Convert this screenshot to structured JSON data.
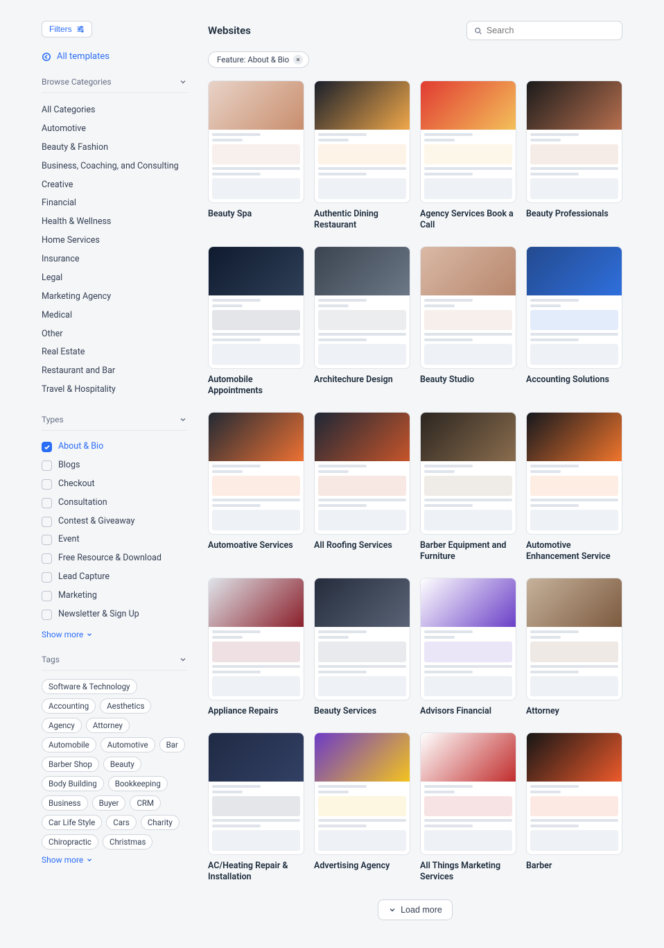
{
  "sidebar": {
    "filters_label": "Filters",
    "all_templates_label": "All templates",
    "browse_categories_label": "Browse Categories",
    "categories": [
      "All Categories",
      "Automotive",
      "Beauty & Fashion",
      "Business, Coaching, and Consulting",
      "Creative",
      "Financial",
      "Health & Wellness",
      "Home Services",
      "Insurance",
      "Legal",
      "Marketing Agency",
      "Medical",
      "Other",
      "Real Estate",
      "Restaurant and Bar",
      "Travel & Hospitality"
    ],
    "types_label": "Types",
    "types": [
      {
        "label": "About & Bio",
        "checked": true
      },
      {
        "label": "Blogs",
        "checked": false
      },
      {
        "label": "Checkout",
        "checked": false
      },
      {
        "label": "Consultation",
        "checked": false
      },
      {
        "label": "Contest & Giveaway",
        "checked": false
      },
      {
        "label": "Event",
        "checked": false
      },
      {
        "label": "Free Resource & Download",
        "checked": false
      },
      {
        "label": "Lead Capture",
        "checked": false
      },
      {
        "label": "Marketing",
        "checked": false
      },
      {
        "label": "Newsletter & Sign Up",
        "checked": false
      }
    ],
    "types_show_more": "Show more",
    "tags_label": "Tags",
    "tags": [
      "Software & Technology",
      "Accounting",
      "Aesthetics",
      "Agency",
      "Attorney",
      "Automobile",
      "Automotive",
      "Bar",
      "Barber Shop",
      "Beauty",
      "Body Building",
      "Bookkeeping",
      "Business",
      "Buyer",
      "CRM",
      "Car Life Style",
      "Cars",
      "Charity",
      "Chiropractic",
      "Christmas"
    ],
    "tags_show_more": "Show more"
  },
  "main": {
    "title": "Websites",
    "search_placeholder": "Search",
    "active_filter_chip": "Feature: About & Bio",
    "templates": [
      {
        "title": "Beauty Spa",
        "hero": "#e8d3c8",
        "accent": "#c98e6d"
      },
      {
        "title": "Authentic Dining Restaurant",
        "hero": "#1a1f2b",
        "accent": "#f0a84a"
      },
      {
        "title": "Agency Services Book a Call",
        "hero": "#e13b32",
        "accent": "#f3c05a"
      },
      {
        "title": "Beauty Professionals",
        "hero": "#1b1b1b",
        "accent": "#b66f4e"
      },
      {
        "title": "Automobile Appointments",
        "hero": "#0f1a2e",
        "accent": "#2e3f57"
      },
      {
        "title": "Architechure Design",
        "hero": "#3b4450",
        "accent": "#6c7887"
      },
      {
        "title": "Beauty Studio",
        "hero": "#d9b9a6",
        "accent": "#b8876d"
      },
      {
        "title": "Accounting Solutions",
        "hero": "#234a8f",
        "accent": "#2f6fdc"
      },
      {
        "title": "Automoative Services",
        "hero": "#222a34",
        "accent": "#ed7133"
      },
      {
        "title": "All Roofing Services",
        "hero": "#1e2736",
        "accent": "#c6552a"
      },
      {
        "title": "Barber Equipment and Furniture",
        "hero": "#2c2620",
        "accent": "#8a6d4e"
      },
      {
        "title": "Automotive Enhancement Service",
        "hero": "#15181e",
        "accent": "#f0752c"
      },
      {
        "title": "Appliance Repairs",
        "hero": "#dfe4ea",
        "accent": "#8a1f2a"
      },
      {
        "title": "Beauty Services",
        "hero": "#252d3d",
        "accent": "#5a6375"
      },
      {
        "title": "Advisors Financial",
        "hero": "#ffffff",
        "accent": "#6a3fc7"
      },
      {
        "title": "Attorney",
        "hero": "#c6b29b",
        "accent": "#7c5a3f"
      },
      {
        "title": "AC/Heating Repair & Installation",
        "hero": "#1f2a44",
        "accent": "#324064"
      },
      {
        "title": "Advertising Agency",
        "hero": "#6c3bc7",
        "accent": "#f3c31f"
      },
      {
        "title": "All Things Marketing Services",
        "hero": "#ffffff",
        "accent": "#c12d2d"
      },
      {
        "title": "Barber",
        "hero": "#161616",
        "accent": "#ed5a2b"
      }
    ],
    "load_more_label": "Load more"
  }
}
